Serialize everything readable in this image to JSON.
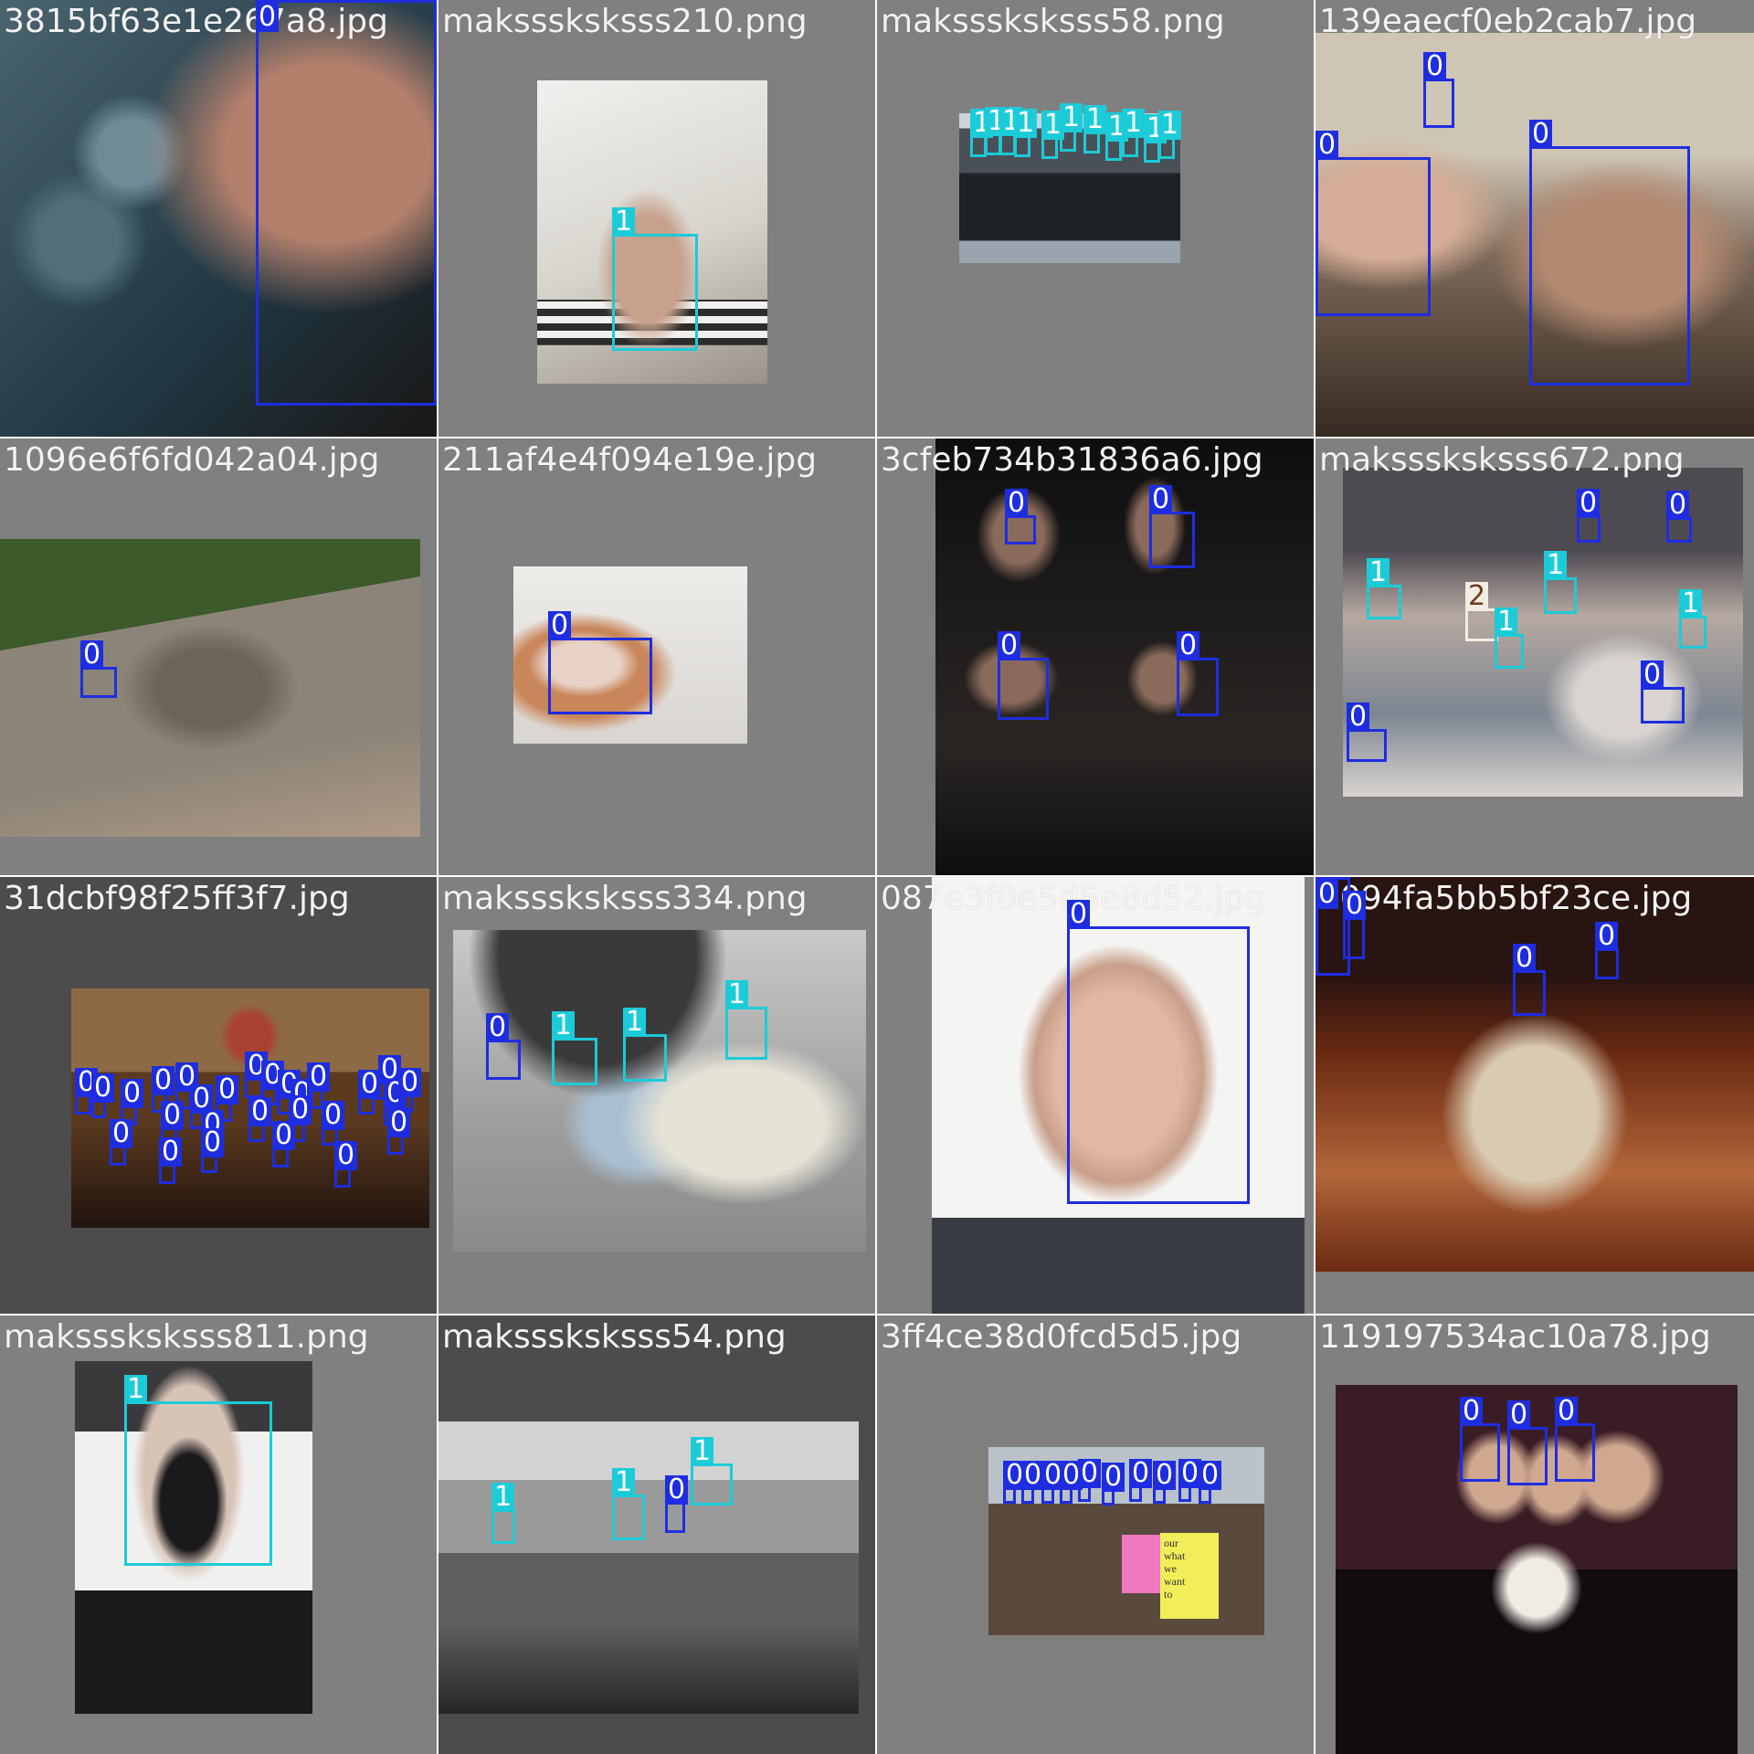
{
  "colors": {
    "class_0": "#1e2de0",
    "class_1": "#1ccbd8",
    "class_2": "#f3ece3",
    "tile_background": "#808080",
    "filename_text": "#f2f2f2"
  },
  "tiles": [
    {
      "filename": "3815bf63e1e267a8.jpg",
      "scene": "close-up of a girl's face with blurred teal bokeh background",
      "palette": [
        "#4a6470",
        "#203844",
        "#b4806c",
        "#1a1716"
      ],
      "detections": [
        {
          "cls": 0,
          "label": "0"
        }
      ]
    },
    {
      "filename": "maksssksksss210.png",
      "scene": "man wearing white respirator mask in front of a spiral staircase",
      "palette": [
        "#d7d4cd",
        "#f1f0ee",
        "#c7a18c",
        "#2c2c2c"
      ],
      "detections": [
        {
          "cls": 1,
          "label": "1"
        }
      ]
    },
    {
      "filename": "maksssksksss58.png",
      "scene": "group of people in dark clothing, many masked faces",
      "palette": [
        "#4a5058",
        "#1f2226",
        "#9aa4ae",
        "#cdd3d8"
      ],
      "detections": [
        {
          "cls": 1,
          "label": "1"
        },
        {
          "cls": 1,
          "label": "1"
        },
        {
          "cls": 1,
          "label": "1"
        },
        {
          "cls": 1,
          "label": "1"
        },
        {
          "cls": 1,
          "label": "1"
        },
        {
          "cls": 1,
          "label": "1"
        },
        {
          "cls": 1,
          "label": "1"
        },
        {
          "cls": 1,
          "label": "1"
        },
        {
          "cls": 1,
          "label": "1"
        },
        {
          "cls": 1,
          "label": "1"
        },
        {
          "cls": 1,
          "label": "1"
        }
      ]
    },
    {
      "filename": "139eaecf0eb2cab7.jpg",
      "scene": "woman smiling at a baby in a warm-lit room",
      "palette": [
        "#cfc5b4",
        "#7d6a5a",
        "#362a22",
        "#b58a72"
      ],
      "detections": [
        {
          "cls": 0,
          "label": "0"
        },
        {
          "cls": 0,
          "label": "0"
        },
        {
          "cls": 0,
          "label": "0"
        }
      ]
    },
    {
      "filename": "1096e6f6fd042a04.jpg",
      "scene": "man leaning on a wooden boardwalk railing beside green grass",
      "palette": [
        "#3c5a2a",
        "#8c8478",
        "#6d6356",
        "#b09a86"
      ],
      "detections": [
        {
          "cls": 0,
          "label": "0"
        }
      ]
    },
    {
      "filename": "211af4e4f094e19e.jpg",
      "scene": "doll with long auburn hair against a white wall",
      "palette": [
        "#eeece9",
        "#c9865a",
        "#e8d2c8",
        "#7c8da0"
      ],
      "detections": [
        {
          "cls": 0,
          "label": "0"
        }
      ]
    },
    {
      "filename": "3cfeb734b31836a6.jpg",
      "scene": "dark collage of spectators and small framed pictures",
      "palette": [
        "#0e0e10",
        "#2a2624",
        "#8a6a5a",
        "#3a3f66"
      ],
      "detections": [
        {
          "cls": 0,
          "label": "0"
        },
        {
          "cls": 0,
          "label": "0"
        },
        {
          "cls": 0,
          "label": "0"
        },
        {
          "cls": 0,
          "label": "0"
        }
      ]
    },
    {
      "filename": "maksssksksss672.png",
      "scene": "crowded group of children and adults, some wearing masks",
      "palette": [
        "#b6a9a1",
        "#4e4a52",
        "#d9d4d0",
        "#7d8692"
      ],
      "detections": [
        {
          "cls": 0,
          "label": "0"
        },
        {
          "cls": 0,
          "label": "0"
        },
        {
          "cls": 1,
          "label": "1"
        },
        {
          "cls": 2,
          "label": "2"
        },
        {
          "cls": 1,
          "label": "1"
        },
        {
          "cls": 1,
          "label": "1"
        },
        {
          "cls": 1,
          "label": "1"
        },
        {
          "cls": 0,
          "label": "0"
        },
        {
          "cls": 0,
          "label": "0"
        }
      ]
    },
    {
      "filename": "31dcbf98f25ff3f7.jpg",
      "scene": "congregation inside a church with wooden arches",
      "palette": [
        "#5b3a20",
        "#21140e",
        "#8e6a44",
        "#aa4231"
      ],
      "detections": [
        {
          "cls": 0,
          "label": "0"
        },
        {
          "cls": 0,
          "label": "0"
        },
        {
          "cls": 0,
          "label": "0"
        },
        {
          "cls": 0,
          "label": "0"
        },
        {
          "cls": 0,
          "label": "0"
        },
        {
          "cls": 0,
          "label": "0"
        },
        {
          "cls": 0,
          "label": "0"
        },
        {
          "cls": 0,
          "label": "0"
        },
        {
          "cls": 0,
          "label": "0"
        },
        {
          "cls": 0,
          "label": "0"
        },
        {
          "cls": 0,
          "label": "0"
        },
        {
          "cls": 0,
          "label": "0"
        },
        {
          "cls": 0,
          "label": "0"
        },
        {
          "cls": 0,
          "label": "0"
        },
        {
          "cls": 0,
          "label": "0"
        },
        {
          "cls": 0,
          "label": "0"
        },
        {
          "cls": 0,
          "label": "0"
        },
        {
          "cls": 0,
          "label": "0"
        },
        {
          "cls": 0,
          "label": "0"
        },
        {
          "cls": 0,
          "label": "0"
        },
        {
          "cls": 0,
          "label": "0"
        },
        {
          "cls": 0,
          "label": "0"
        },
        {
          "cls": 0,
          "label": "0"
        },
        {
          "cls": 0,
          "label": "0"
        },
        {
          "cls": 0,
          "label": "0"
        },
        {
          "cls": 0,
          "label": "0"
        },
        {
          "cls": 0,
          "label": "0"
        }
      ]
    },
    {
      "filename": "maksssksksss334.png",
      "scene": "people in raincoats under an umbrella, several wearing masks",
      "palette": [
        "#c9c9c9",
        "#3a3a3a",
        "#e6e3d6",
        "#a9c0d2"
      ],
      "detections": [
        {
          "cls": 0,
          "label": "0"
        },
        {
          "cls": 1,
          "label": "1"
        },
        {
          "cls": 1,
          "label": "1"
        },
        {
          "cls": 1,
          "label": "1"
        }
      ]
    },
    {
      "filename": "087e3f0e5d5e8d52.jpg",
      "scene": "portrait of a bald man in a plaid shirt on white background",
      "palette": [
        "#f4f4f2",
        "#e0b8a4",
        "#3a3c44",
        "#c89f8a"
      ],
      "detections": [
        {
          "cls": 0,
          "label": "0"
        }
      ]
    },
    {
      "filename": "1094fa5bb5bf23ce.jpg",
      "scene": "people examining a mummy on a table under orange light",
      "palette": [
        "#6b2a12",
        "#d9cab2",
        "#281410",
        "#b3663a"
      ],
      "detections": [
        {
          "cls": 0,
          "label": "0"
        },
        {
          "cls": 0,
          "label": "0"
        },
        {
          "cls": 0,
          "label": "0"
        },
        {
          "cls": 0,
          "label": "0"
        }
      ]
    },
    {
      "filename": "maksssksksss811.png",
      "scene": "person with black skull-print face mask and dark hair",
      "palette": [
        "#f0f0ef",
        "#1a1a1c",
        "#d8c3b7",
        "#3a3a3c"
      ],
      "detections": [
        {
          "cls": 1,
          "label": "1"
        }
      ]
    },
    {
      "filename": "maksssksksss54.png",
      "scene": "people walking in a mall, several wearing black masks",
      "palette": [
        "#9a9a9a",
        "#262626",
        "#d2d2d2",
        "#5e5e5e"
      ],
      "detections": [
        {
          "cls": 1,
          "label": "1"
        },
        {
          "cls": 1,
          "label": "1"
        },
        {
          "cls": 0,
          "label": "0"
        },
        {
          "cls": 1,
          "label": "1"
        }
      ]
    },
    {
      "filename": "3ff4ce38d0fcd5d5.jpg",
      "scene": "street protest with pink and yellow handwritten signs",
      "palette": [
        "#b9c2c9",
        "#5a4a3e",
        "#f078c0",
        "#f2ee5a"
      ],
      "signs": [
        "our",
        "what",
        "we",
        "want",
        "to"
      ],
      "detections": [
        {
          "cls": 0,
          "label": "0"
        },
        {
          "cls": 0,
          "label": "0"
        },
        {
          "cls": 0,
          "label": "0"
        },
        {
          "cls": 0,
          "label": "0"
        },
        {
          "cls": 0,
          "label": "0"
        },
        {
          "cls": 0,
          "label": "0"
        },
        {
          "cls": 0,
          "label": "0"
        },
        {
          "cls": 0,
          "label": "0"
        },
        {
          "cls": 0,
          "label": "0"
        },
        {
          "cls": 0,
          "label": "0"
        }
      ]
    },
    {
      "filename": "119197534ac10a78.jpg",
      "scene": "three women posing together at night",
      "palette": [
        "#3a1c24",
        "#120c10",
        "#d0a890",
        "#f0ece4"
      ],
      "detections": [
        {
          "cls": 0,
          "label": "0"
        },
        {
          "cls": 0,
          "label": "0"
        },
        {
          "cls": 0,
          "label": "0"
        }
      ]
    }
  ]
}
